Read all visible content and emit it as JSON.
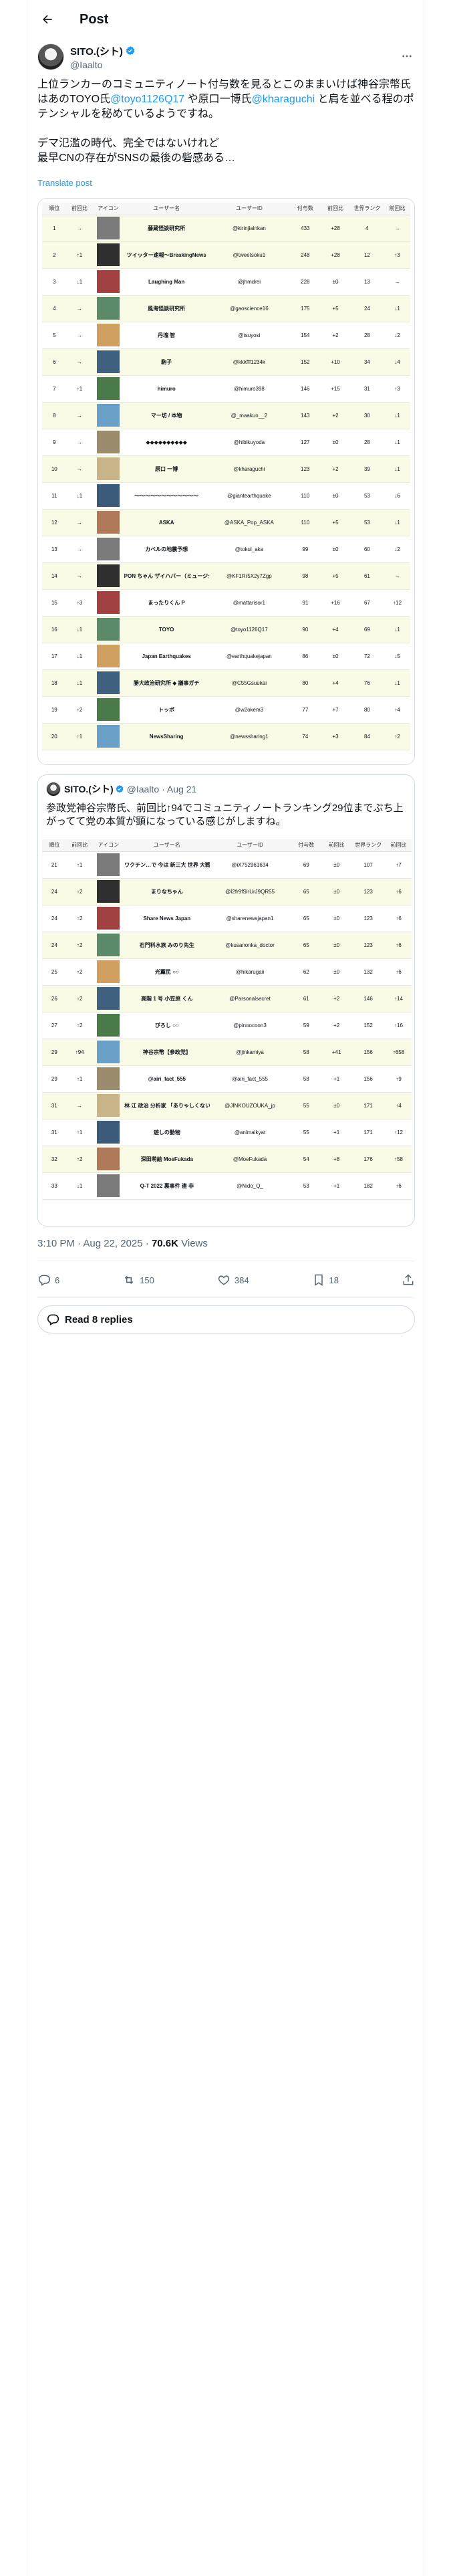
{
  "header": {
    "title": "Post"
  },
  "author": {
    "name": "SITO.(シト)",
    "handle": "@Iaalto"
  },
  "post": {
    "text_parts": [
      {
        "t": "上位ランカーのコミュニティノート付与数を見るとこのままいけば神谷宗幣氏はあのTOYO氏",
        "m": false
      },
      {
        "t": "@toyo1126Q17",
        "m": true
      },
      {
        "t": " や原口一博氏",
        "m": false
      },
      {
        "t": "@kharaguchi",
        "m": true
      },
      {
        "t": " と肩を並べる程のポテンシャルを秘めているようですね。\n\nデマ氾濫の時代、完全ではないけれど\n最早CNの存在がSNSの最後の砦感ある…",
        "m": false
      }
    ],
    "translate": "Translate post"
  },
  "table_headers": [
    "順位",
    "前回比",
    "アイコン",
    "ユーザー名",
    "ユーザーID",
    "付与数",
    "前回比",
    "世界ランク",
    "前回比"
  ],
  "table1": [
    {
      "rank": "1",
      "chg": "→",
      "name": "藤蔵怪談研究所",
      "id": "@kirinjiainkan",
      "cnt": "433",
      "d": "+28",
      "world": "4",
      "wd": "→",
      "y": true
    },
    {
      "rank": "2",
      "chg": "↑1",
      "name": "ツイッター速報〜BreakingNews",
      "id": "@tweetsoku1",
      "cnt": "248",
      "d": "+28",
      "world": "12",
      "wd": "↑3",
      "y": true
    },
    {
      "rank": "3",
      "chg": "↓1",
      "name": "Laughing Man",
      "id": "@jhmdrei",
      "cnt": "228",
      "d": "±0",
      "world": "13",
      "wd": "→",
      "y": false
    },
    {
      "rank": "4",
      "chg": "→",
      "name": "風海怪談研究所",
      "id": "@gaoscience16",
      "cnt": "175",
      "d": "+5",
      "world": "24",
      "wd": "↓1",
      "y": true
    },
    {
      "rank": "5",
      "chg": "→",
      "name": "丹塊 智",
      "id": "@tsuyosi",
      "cnt": "154",
      "d": "+2",
      "world": "28",
      "wd": "↓2",
      "y": false
    },
    {
      "rank": "6",
      "chg": "→",
      "name": "駒子",
      "id": "@kkkfff1234k",
      "cnt": "152",
      "d": "+10",
      "world": "34",
      "wd": "↓4",
      "y": true
    },
    {
      "rank": "7",
      "chg": "↑1",
      "name": "himuro",
      "id": "@himuro398",
      "cnt": "146",
      "d": "+15",
      "world": "31",
      "wd": "↑3",
      "y": false
    },
    {
      "rank": "8",
      "chg": "→",
      "name": "マー坊 / 本物",
      "id": "@_maakun__2",
      "cnt": "143",
      "d": "+2",
      "world": "30",
      "wd": "↓1",
      "y": true
    },
    {
      "rank": "9",
      "chg": "→",
      "name": "◆◆◆◆◆◆◆◆◆◆",
      "id": "@hibikuyoda",
      "cnt": "127",
      "d": "±0",
      "world": "28",
      "wd": "↓1",
      "y": false
    },
    {
      "rank": "10",
      "chg": "→",
      "name": "原口 一博",
      "id": "@kharaguchi",
      "cnt": "123",
      "d": "+2",
      "world": "39",
      "wd": "↓1",
      "y": true
    },
    {
      "rank": "11",
      "chg": "↓1",
      "name": "〜〜〜〜〜〜〜〜〜〜〜〜",
      "id": "@giantearthquake",
      "cnt": "110",
      "d": "±0",
      "world": "53",
      "wd": "↓6",
      "y": false
    },
    {
      "rank": "12",
      "chg": "→",
      "name": "ASKA",
      "id": "@ASKA_Pop_ASKA",
      "cnt": "110",
      "d": "+5",
      "world": "53",
      "wd": "↓1",
      "y": true
    },
    {
      "rank": "13",
      "chg": "→",
      "name": "カベルの地震予想",
      "id": "@tokul_aka",
      "cnt": "99",
      "d": "±0",
      "world": "60",
      "wd": "↓2",
      "y": false
    },
    {
      "rank": "14",
      "chg": "→",
      "name": "PON ちゃん ザイハバー（ミュージシャン 漁師 しんや）",
      "id": "@KF1Rr5X2y7Zgp",
      "cnt": "98",
      "d": "+5",
      "world": "61",
      "wd": "→",
      "y": true
    },
    {
      "rank": "15",
      "chg": "↑3",
      "name": "まったりくん P",
      "id": "@mattarisor1",
      "cnt": "91",
      "d": "+16",
      "world": "67",
      "wd": "↑12",
      "y": false
    },
    {
      "rank": "16",
      "chg": "↓1",
      "name": "TOYO",
      "id": "@toyo1126Q17",
      "cnt": "90",
      "d": "+4",
      "world": "69",
      "wd": "↓1",
      "y": true
    },
    {
      "rank": "17",
      "chg": "↓1",
      "name": "Japan Earthquakes",
      "id": "@earthquakejapan",
      "cnt": "86",
      "d": "±0",
      "world": "72",
      "wd": "↓5",
      "y": false
    },
    {
      "rank": "18",
      "chg": "↓1",
      "name": "勝大政治研究所 ◆ 議事ガチ",
      "id": "@C55Gsuukai",
      "cnt": "80",
      "d": "+4",
      "world": "76",
      "wd": "↓1",
      "y": true
    },
    {
      "rank": "19",
      "chg": "↑2",
      "name": "トッポ",
      "id": "@w2okem3",
      "cnt": "77",
      "d": "+7",
      "world": "80",
      "wd": "↑4",
      "y": false
    },
    {
      "rank": "20",
      "chg": "↑1",
      "name": "NewsSharing",
      "id": "@newssharing1",
      "cnt": "74",
      "d": "+3",
      "world": "84",
      "wd": "↑2",
      "y": true
    }
  ],
  "quote": {
    "name": "SITO.(シト)",
    "handle": "@Iaalto",
    "date": "· Aug 21",
    "text": "参政党神谷宗幣氏、前回比↑94でコミュニティノートランキング29位までぶち上がってて党の本質が顕になっている感じがしますね。"
  },
  "table2": [
    {
      "rank": "21",
      "chg": "↑1",
      "name": "ワクチン…で 今は 新三大 世界 大戦争",
      "id": "@iX752961634",
      "cnt": "69",
      "d": "±0",
      "world": "107",
      "wd": "↑7",
      "y": false
    },
    {
      "rank": "24",
      "chg": "↑2",
      "name": "まりなちゃん",
      "id": "@I2fr9fShUrJ9QR55",
      "cnt": "65",
      "d": "±0",
      "world": "123",
      "wd": "↑6",
      "y": true
    },
    {
      "rank": "24",
      "chg": "↑2",
      "name": "Share News Japan",
      "id": "@sharenewsjapan1",
      "cnt": "65",
      "d": "±0",
      "world": "123",
      "wd": "↑6",
      "y": false
    },
    {
      "rank": "24",
      "chg": "↑2",
      "name": "石門科水族 みのり先生",
      "id": "@kusanonka_doctor",
      "cnt": "65",
      "d": "±0",
      "world": "123",
      "wd": "↑6",
      "y": true
    },
    {
      "rank": "25",
      "chg": "↑2",
      "name": "光薫民 ○○",
      "id": "@hikarugaii",
      "cnt": "62",
      "d": "±0",
      "world": "132",
      "wd": "↑6",
      "y": false
    },
    {
      "rank": "26",
      "chg": "↑2",
      "name": "高階 1 号 小笠原 くん",
      "id": "@Parsonalsecret",
      "cnt": "61",
      "d": "+2",
      "world": "146",
      "wd": "↑14",
      "y": true
    },
    {
      "rank": "27",
      "chg": "↑2",
      "name": "ぴろし ○○",
      "id": "@pinoocoon3",
      "cnt": "59",
      "d": "+2",
      "world": "152",
      "wd": "↑16",
      "y": false
    },
    {
      "rank": "29",
      "chg": "↑94",
      "name": "神谷宗幣【参政党】",
      "id": "@jinkamiya",
      "cnt": "58",
      "d": "+41",
      "world": "156",
      "wd": "↑658",
      "y": true
    },
    {
      "rank": "29",
      "chg": "↑1",
      "name": "@airi_fact_555",
      "id": "@airi_fact_555",
      "cnt": "58",
      "d": "+1",
      "world": "156",
      "wd": "↑9",
      "y": false
    },
    {
      "rank": "31",
      "chg": "→",
      "name": "林 江 政治 分析家 「ありゃしくないですから!!! 日本人…」",
      "id": "@JINKOUZOUKA_jp",
      "cnt": "55",
      "d": "±0",
      "world": "171",
      "wd": "↑4",
      "y": true
    },
    {
      "rank": "31",
      "chg": "↑1",
      "name": "遊しの動物",
      "id": "@animalkyat",
      "cnt": "55",
      "d": "+1",
      "world": "171",
      "wd": "↑12",
      "y": false
    },
    {
      "rank": "32",
      "chg": "↑2",
      "name": "深田萌絵 MoeFukada",
      "id": "@MoeFukada",
      "cnt": "54",
      "d": "+8",
      "world": "176",
      "wd": "↑58",
      "y": true
    },
    {
      "rank": "33",
      "chg": "↓1",
      "name": "Q-T 2022 裏事件 連 非",
      "id": "@Nido_Q_",
      "cnt": "53",
      "d": "+1",
      "world": "182",
      "wd": "↑6",
      "y": false
    }
  ],
  "meta": {
    "time": "3:10 PM · Aug 22, 2025 · ",
    "views": "70.6K",
    "views_label": " Views"
  },
  "actions": {
    "replies": "6",
    "reposts": "150",
    "likes": "384",
    "bookmarks": "18"
  },
  "read_replies": "Read 8 replies",
  "colors": {
    "accent": "#1d9bf0",
    "row_highlight": "#fafbe6"
  }
}
